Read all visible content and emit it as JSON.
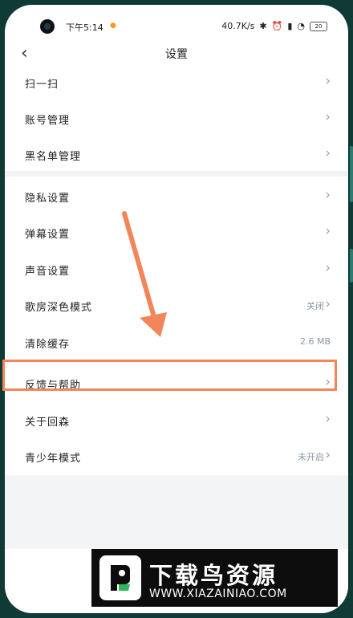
{
  "status_bar": {
    "time": "下午5:14",
    "network_speed": "40.7K/s",
    "battery": "20",
    "icons": [
      "bluetooth-icon",
      "alarm-icon",
      "signal-icon",
      "wifi-icon",
      "battery-icon"
    ]
  },
  "header": {
    "title": "设置",
    "back_icon": "chevron-left-icon"
  },
  "groups": [
    {
      "items": [
        {
          "label": "扫一扫",
          "value": ""
        },
        {
          "label": "账号管理",
          "value": ""
        },
        {
          "label": "黑名单管理",
          "value": ""
        }
      ]
    },
    {
      "items": [
        {
          "label": "隐私设置",
          "value": ""
        },
        {
          "label": "弹幕设置",
          "value": ""
        },
        {
          "label": "声音设置",
          "value": ""
        },
        {
          "label": "歌房深色模式",
          "value": "关闭"
        },
        {
          "label": "清除缓存",
          "value": "2.6 MB"
        },
        {
          "label": "反馈与帮助",
          "value": ""
        },
        {
          "label": "关于回森",
          "value": ""
        },
        {
          "label": "青少年模式",
          "value": "未开启"
        }
      ]
    }
  ],
  "highlighted_item": "反馈与帮助",
  "colors": {
    "accent": "#f3855a",
    "frame": "#0f3a36",
    "watermark_bg": "#0d0d0d"
  },
  "watermark": {
    "title": "下载鸟资源",
    "url": "WWW.XIAZAINIAO.COM"
  }
}
